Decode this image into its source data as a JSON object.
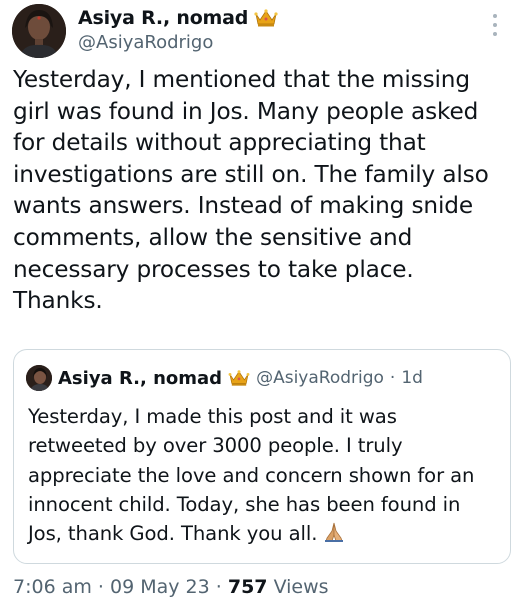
{
  "tweet": {
    "author": {
      "display_name": "Asiya R., nomad",
      "badge_icon": "crown-icon",
      "handle": "@AsiyaRodrigo"
    },
    "more_icon": "more-vertical-icon",
    "text": "Yesterday, I mentioned that the missing girl was found in Jos. Many people asked for details without appreciating that investigations are still on. The family also wants answers. Instead of making snide comments, allow the sensitive and necessary processes to take place. Thanks.",
    "quoted": {
      "display_name": "Asiya R., nomad",
      "badge_icon": "crown-icon",
      "handle": "@AsiyaRodrigo",
      "separator": "·",
      "time": "1d",
      "text": "Yesterday, I made this post and it was retweeted by over 3000 people. I truly appreciate the love and concern shown for an innocent child. Today, she has been found in Jos, thank God. Thank you all.",
      "emoji_icon": "folded-hands-icon"
    },
    "meta": {
      "time": "7:06 am",
      "separator": "·",
      "date": "09 May 23",
      "views_count": "757",
      "views_label": "Views"
    }
  },
  "colors": {
    "primary_text": "#0f1419",
    "secondary_text": "#536471",
    "border": "#cfd9de",
    "crown_gold": "#e8a317"
  }
}
